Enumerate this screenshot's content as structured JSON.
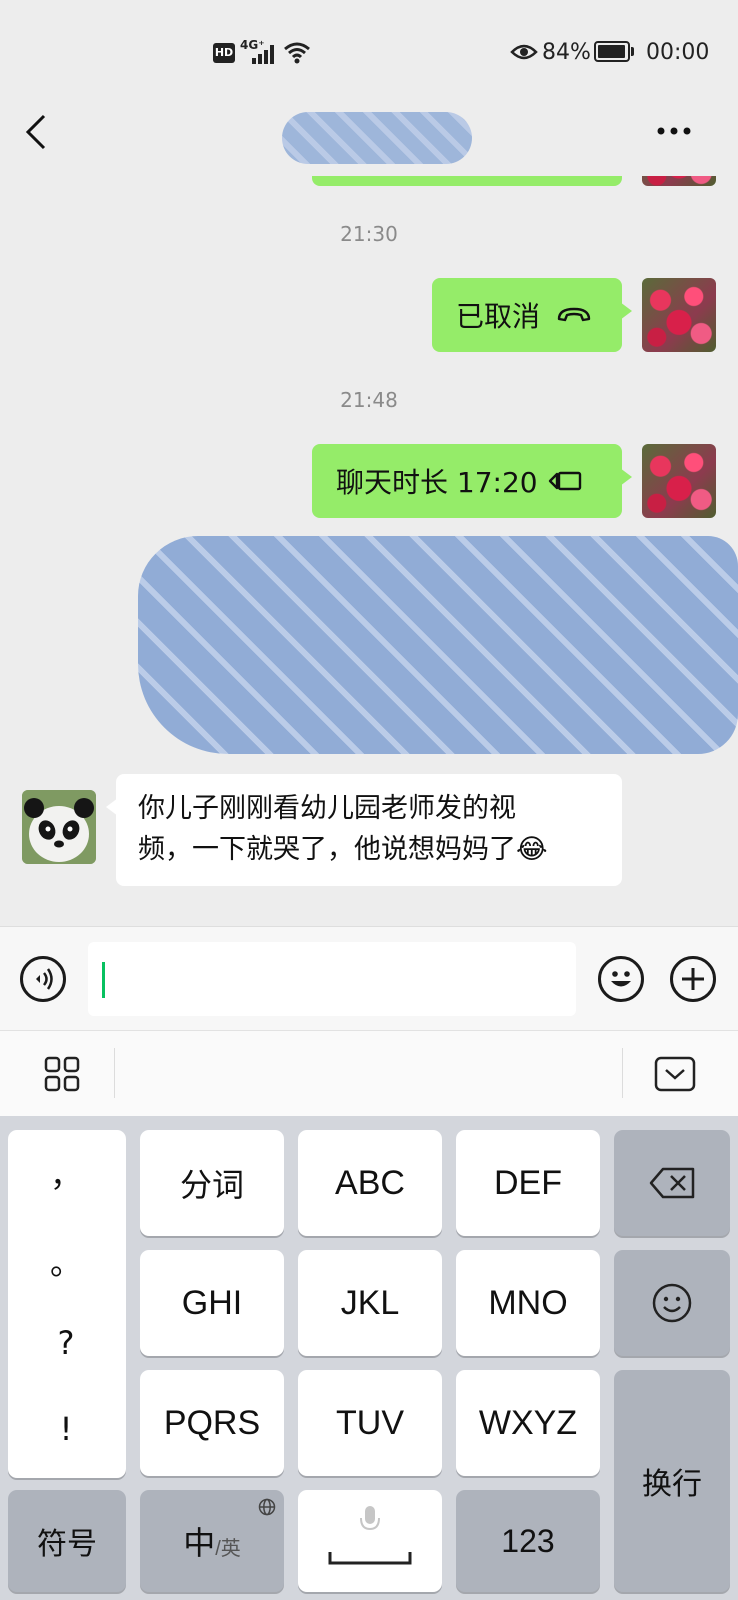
{
  "status_bar": {
    "hd": "HD",
    "network": "4G⁺",
    "battery_percent": "84%",
    "time": "00:00",
    "battery_level": 0.84
  },
  "header": {
    "back_icon": "chevron-left-icon",
    "more_icon": "more-dots-icon",
    "title": ""
  },
  "messages": [
    {
      "type": "time",
      "text": "21:30"
    },
    {
      "type": "call-cancel",
      "side": "out",
      "text": "已取消",
      "icon": "hangup-icon"
    },
    {
      "type": "time",
      "text": "21:48"
    },
    {
      "type": "video-call",
      "side": "out",
      "text": "聊天时长 17:20",
      "icon": "video-camera-icon"
    },
    {
      "type": "text",
      "side": "in",
      "lines": [
        "你儿子刚刚看幼儿园老师发的视",
        "频，一下就哭了，他说想妈妈了"
      ],
      "emoji": "😂"
    }
  ],
  "input_bar": {
    "voice_icon": "voice-icon",
    "emoji_icon": "smiley-icon",
    "plus_icon": "plus-icon",
    "value": ""
  },
  "ime_toolbar": {
    "menu_icon": "grid-icon",
    "collapse_icon": "collapse-keyboard-icon"
  },
  "keyboard": {
    "symbols": [
      "，",
      "。",
      "?",
      "!"
    ],
    "rows": [
      [
        "分词",
        "ABC",
        "DEF"
      ],
      [
        "GHI",
        "JKL",
        "MNO"
      ],
      [
        "PQRS",
        "TUV",
        "WXYZ"
      ]
    ],
    "backspace_icon": "backspace-icon",
    "emoji_icon": "smiley-icon",
    "enter": "换行",
    "symbol_key": "符号",
    "lang_main": "中",
    "lang_sub": "/英",
    "space_icon": "mic-icon",
    "num_key": "123",
    "globe_icon": "globe-icon"
  },
  "colors": {
    "wechat_green": "#95ec69",
    "accent": "#07c160"
  }
}
